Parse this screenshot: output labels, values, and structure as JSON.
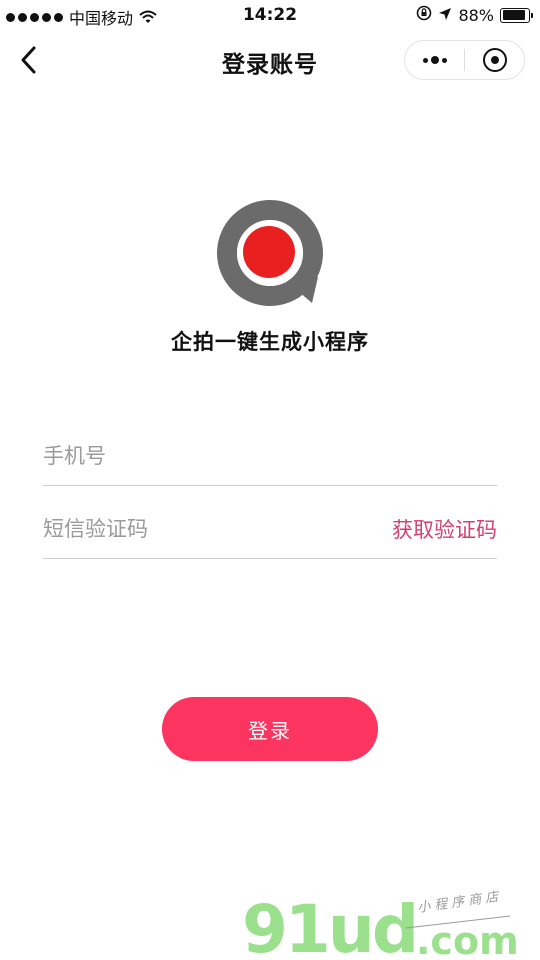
{
  "status_bar": {
    "carrier": "中国移动",
    "time": "14:22",
    "battery_text": "88%",
    "battery_level": 0.88
  },
  "nav": {
    "title": "登录账号",
    "back_icon": "chevron-left-icon",
    "more_icon": "more-dots-icon",
    "close_icon": "target-icon"
  },
  "logo": {
    "ring_color": "#6b6b6b",
    "dot_color": "#e8201f"
  },
  "brand": {
    "name": "企拍一键生成小程序"
  },
  "form": {
    "phone_placeholder": "手机号",
    "code_placeholder": "短信验证码",
    "get_code_label": "获取验证码",
    "login_label": "登录",
    "accent_color": "#fb355f",
    "link_color": "#d43f6f"
  },
  "watermark": {
    "text_main": "91ud",
    "text_domain": ".com",
    "tagline": "小 程 序 商 店"
  }
}
